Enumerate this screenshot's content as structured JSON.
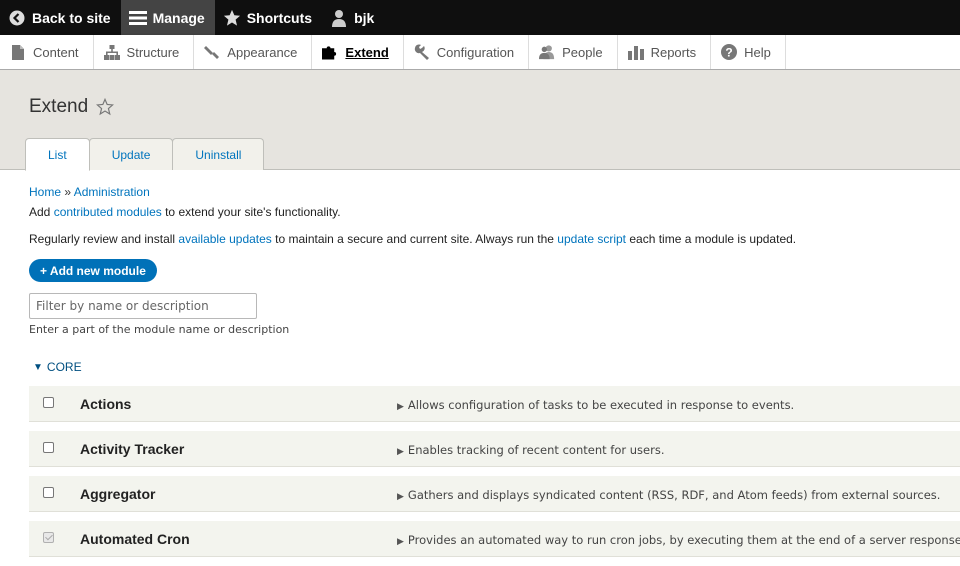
{
  "toolbar": {
    "back_label": "Back to site",
    "manage_label": "Manage",
    "shortcuts_label": "Shortcuts",
    "user_label": "bjk"
  },
  "tray": {
    "items": [
      {
        "label": "Content",
        "icon": "file-icon"
      },
      {
        "label": "Structure",
        "icon": "sitemap-icon"
      },
      {
        "label": "Appearance",
        "icon": "paintbrush-icon"
      },
      {
        "label": "Extend",
        "icon": "puzzle-icon"
      },
      {
        "label": "Configuration",
        "icon": "wrench-icon"
      },
      {
        "label": "People",
        "icon": "people-icon"
      },
      {
        "label": "Reports",
        "icon": "bar-chart-icon"
      },
      {
        "label": "Help",
        "icon": "help-icon"
      }
    ]
  },
  "page": {
    "title": "Extend",
    "tabs": [
      {
        "label": "List"
      },
      {
        "label": "Update"
      },
      {
        "label": "Uninstall"
      }
    ]
  },
  "breadcrumb": {
    "home": "Home",
    "sep": "»",
    "admin": "Administration"
  },
  "intro": {
    "line1_pre": "Add ",
    "line1_link": "contributed modules",
    "line1_post": " to extend your site's functionality.",
    "line2_pre": "Regularly review and install ",
    "line2_link1": "available updates",
    "line2_mid": " to maintain a secure and current site. Always run the ",
    "line2_link2": "update script",
    "line2_post": " each time a module is updated."
  },
  "add_button": "+ Add new module",
  "filter": {
    "placeholder": "Filter by name or description",
    "description": "Enter a part of the module name or description"
  },
  "core": {
    "label": "CORE",
    "modules": [
      {
        "name": "Actions",
        "description": "Allows configuration of tasks to be executed in response to events.",
        "checked": false
      },
      {
        "name": "Activity Tracker",
        "description": "Enables tracking of recent content for users.",
        "checked": false
      },
      {
        "name": "Aggregator",
        "description": "Gathers and displays syndicated content (RSS, RDF, and Atom feeds) from external sources.",
        "checked": false
      },
      {
        "name": "Automated Cron",
        "description": "Provides an automated way to run cron jobs, by executing them at the end of a server response.",
        "checked": true
      }
    ]
  }
}
